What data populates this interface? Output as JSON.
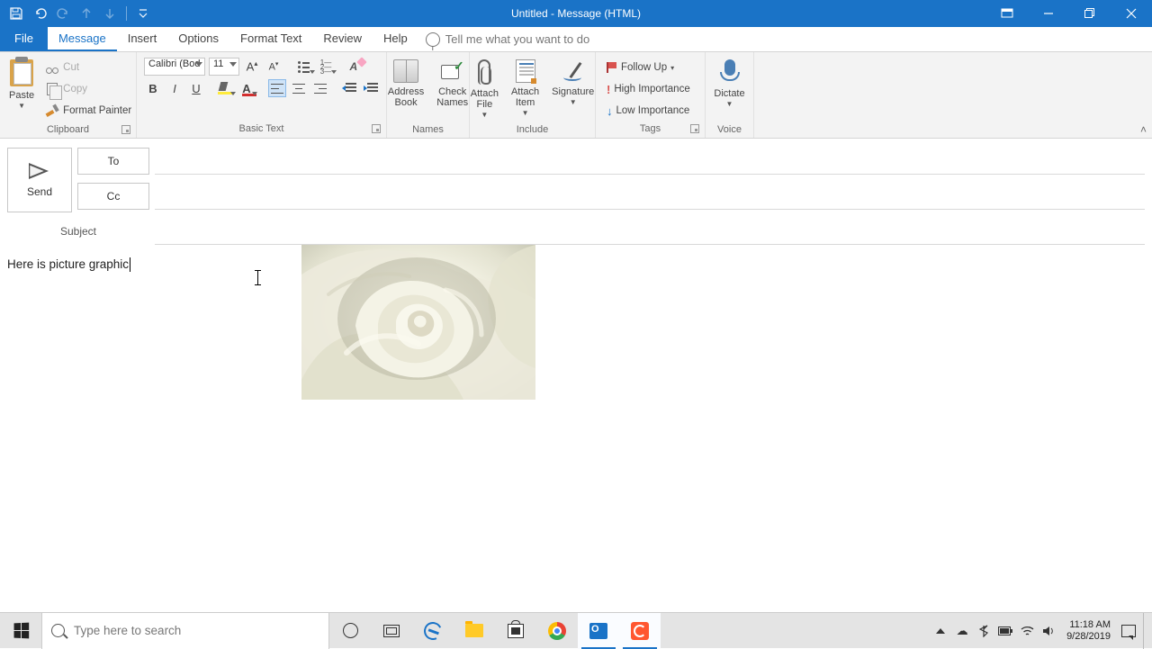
{
  "window": {
    "title": "Untitled - Message (HTML)"
  },
  "ribbon": {
    "tabs": {
      "file": "File",
      "message": "Message",
      "insert": "Insert",
      "options": "Options",
      "format_text": "Format Text",
      "review": "Review",
      "help": "Help"
    },
    "tell_me": "Tell me what you want to do",
    "groups": {
      "clipboard": {
        "label": "Clipboard",
        "paste": "Paste",
        "cut": "Cut",
        "copy": "Copy",
        "format_painter": "Format Painter"
      },
      "basic_text": {
        "label": "Basic Text",
        "font_name": "Calibri (Bod",
        "font_size": "11"
      },
      "names": {
        "label": "Names",
        "address_book": "Address\nBook",
        "check_names": "Check\nNames"
      },
      "include": {
        "label": "Include",
        "attach_file": "Attach\nFile",
        "attach_item": "Attach\nItem",
        "signature": "Signature"
      },
      "tags": {
        "label": "Tags",
        "follow_up": "Follow Up",
        "high_importance": "High Importance",
        "low_importance": "Low Importance"
      },
      "voice": {
        "label": "Voice",
        "dictate": "Dictate"
      }
    }
  },
  "compose": {
    "send": "Send",
    "to_label": "To",
    "cc_label": "Cc",
    "subject_label": "Subject",
    "to_value": "",
    "cc_value": "",
    "subject_value": "",
    "body_text": "Here is picture graphic"
  },
  "taskbar": {
    "search_placeholder": "Type here to search",
    "time": "11:18 AM",
    "date": "9/28/2019"
  }
}
